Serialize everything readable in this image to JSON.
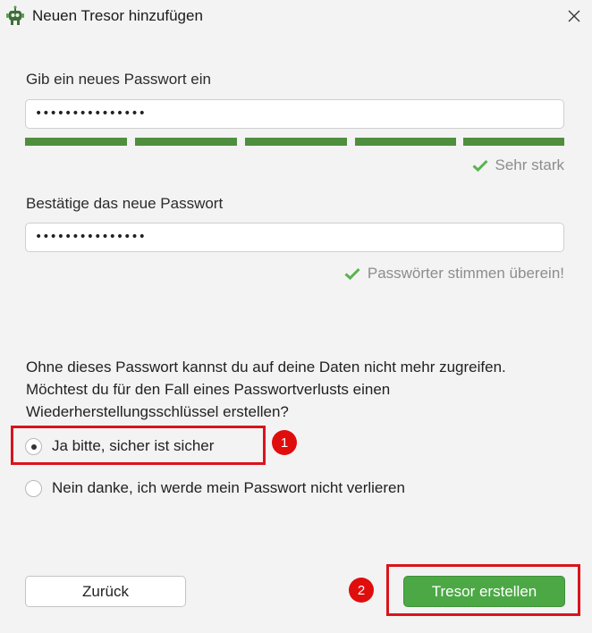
{
  "window": {
    "title": "Neuen Tresor hinzufügen",
    "icon": "cryptomator-robot-icon",
    "close_icon": "close-icon"
  },
  "new_password": {
    "label": "Gib ein neues Passwort ein",
    "value": "•••••••••••••••",
    "strength_segments_filled": 5,
    "strength_segments_total": 5,
    "strength_color": "#4e8e3e",
    "strength_text": "Sehr stark"
  },
  "confirm_password": {
    "label": "Bestätige das neue Passwort",
    "value": "•••••••••••••••",
    "match_text": "Passwörter stimmen überein!"
  },
  "recovery": {
    "question": "Ohne dieses Passwort kannst du auf deine Daten nicht mehr zugreifen. Möchtest du für den Fall eines Passwortverlusts einen Wiederherstellungsschlüssel erstellen?",
    "options": [
      {
        "label": "Ja bitte, sicher ist sicher",
        "selected": true
      },
      {
        "label": "Nein danke, ich werde mein Passwort nicht verlieren",
        "selected": false
      }
    ]
  },
  "annotations": {
    "badge1": "1",
    "badge2": "2",
    "color": "#d9141b"
  },
  "buttons": {
    "back": "Zurück",
    "create": "Tresor erstellen",
    "create_color": "#4ca845"
  }
}
